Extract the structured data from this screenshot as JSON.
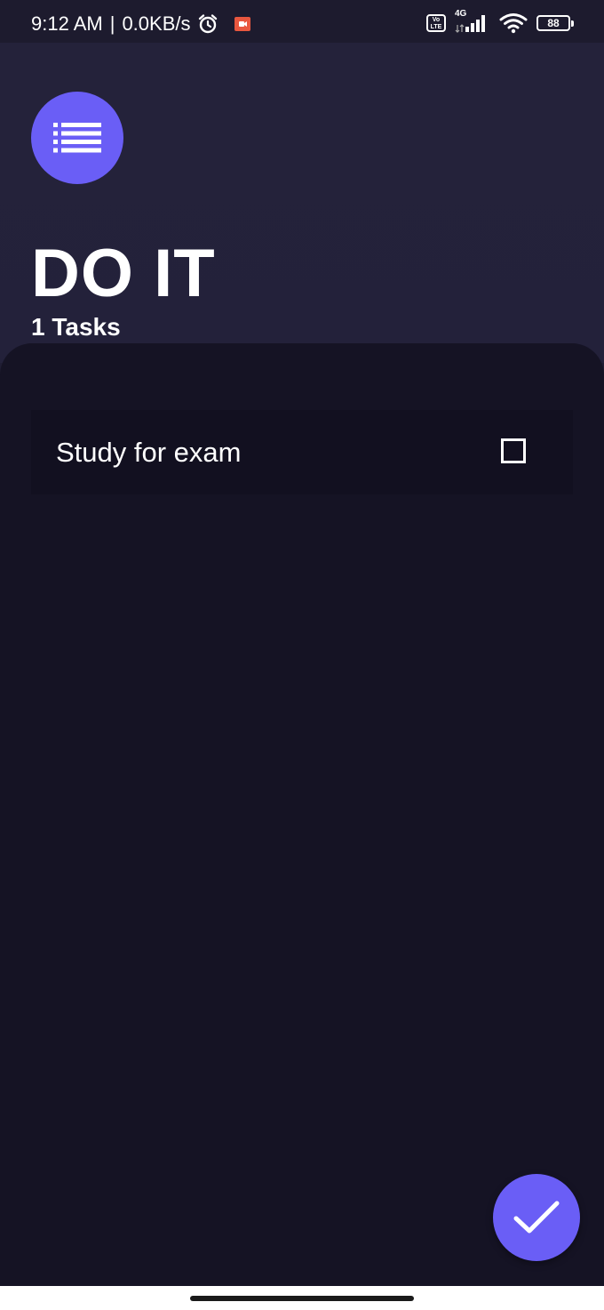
{
  "status_bar": {
    "time": "9:12 AM",
    "separator": "|",
    "network_speed": "0.0KB/s",
    "alarm_icon": "alarm-clock-icon",
    "recording_icon": "screen-record-icon",
    "volte_label": "Vo LTE",
    "network_type": "4G",
    "battery_level": "88",
    "colors": {
      "recording": "#e8573f"
    }
  },
  "header": {
    "menu_icon": "list-icon",
    "title": "DO IT",
    "task_count": "1 Tasks"
  },
  "tasks": [
    {
      "label": "Study for exam",
      "checked": false
    }
  ],
  "fab": {
    "icon": "check-icon"
  },
  "colors": {
    "accent": "#6a5ef6",
    "header_bg": "#24223a",
    "panel_bg": "#151324",
    "task_bg": "#121020"
  }
}
